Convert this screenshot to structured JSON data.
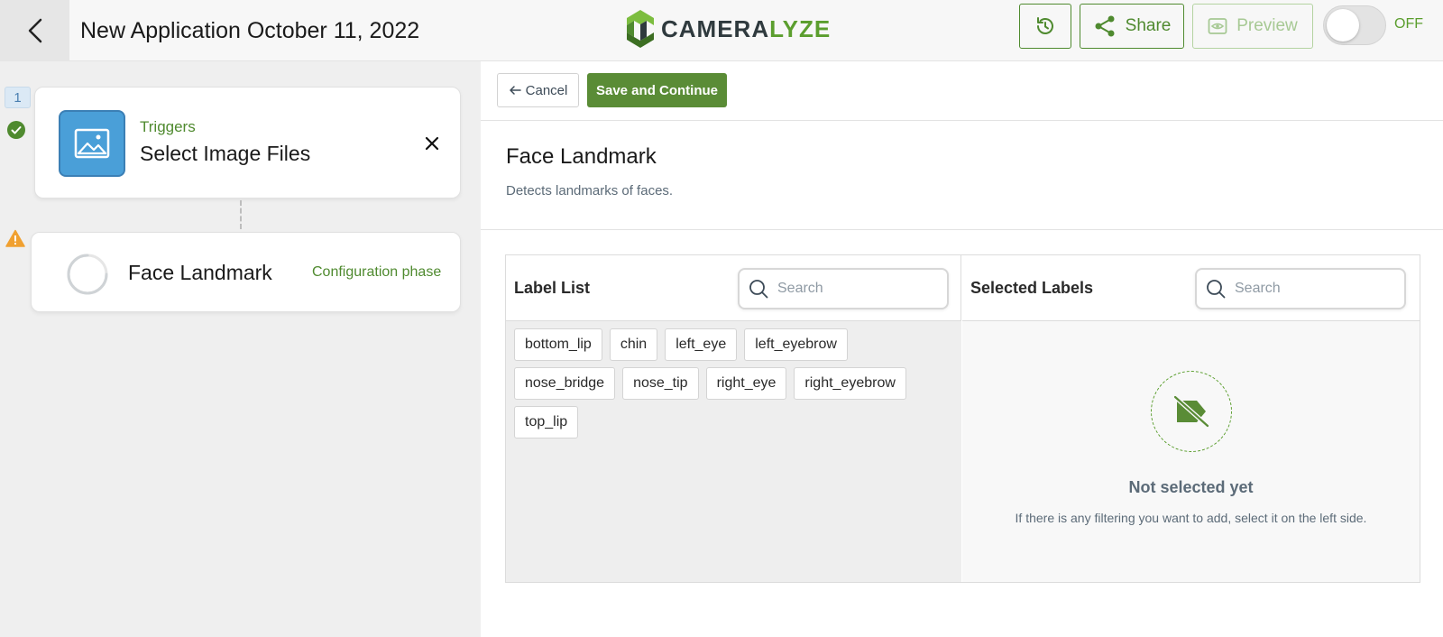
{
  "header": {
    "title": "New Application October 11, 2022",
    "logo": {
      "prefix": "CAMERA",
      "suffix": "LYZE",
      "icon": "cameralyze-logo-icon"
    },
    "history_icon": "history-icon",
    "share_label": "Share",
    "share_icon": "share-icon",
    "preview_label": "Preview",
    "preview_icon": "eye-icon",
    "preview_disabled": true,
    "toggle_label": "OFF",
    "toggle_on": false
  },
  "pipeline": {
    "steps": [
      {
        "number": "1",
        "status": "done",
        "status_icon": "check-circle-icon",
        "category": "Triggers",
        "title": "Select Image Files",
        "icon": "image-icon",
        "close_icon": "close-icon"
      },
      {
        "status": "warning",
        "status_icon": "warning-triangle-icon",
        "title": "Face Landmark",
        "phase": "Configuration phase",
        "icon": "spinner-icon"
      }
    ]
  },
  "toolbar": {
    "cancel_label": "Cancel",
    "cancel_icon": "arrow-left-icon",
    "save_label": "Save and Continue"
  },
  "model": {
    "title": "Face Landmark",
    "description": "Detects landmarks of faces."
  },
  "label_list": {
    "title": "Label List",
    "search_placeholder": "Search",
    "labels": [
      "bottom_lip",
      "chin",
      "left_eye",
      "left_eyebrow",
      "nose_bridge",
      "nose_tip",
      "right_eye",
      "right_eyebrow",
      "top_lip"
    ]
  },
  "selected_labels": {
    "title": "Selected Labels",
    "search_placeholder": "Search",
    "empty_icon": "label-off-icon",
    "empty_title": "Not selected yet",
    "empty_hint": "If there is any filtering you want to add, select it on the left side."
  },
  "colors": {
    "brand_green": "#5a8c36",
    "trigger_blue": "#4a9fd8",
    "warning_orange": "#f0a030"
  }
}
